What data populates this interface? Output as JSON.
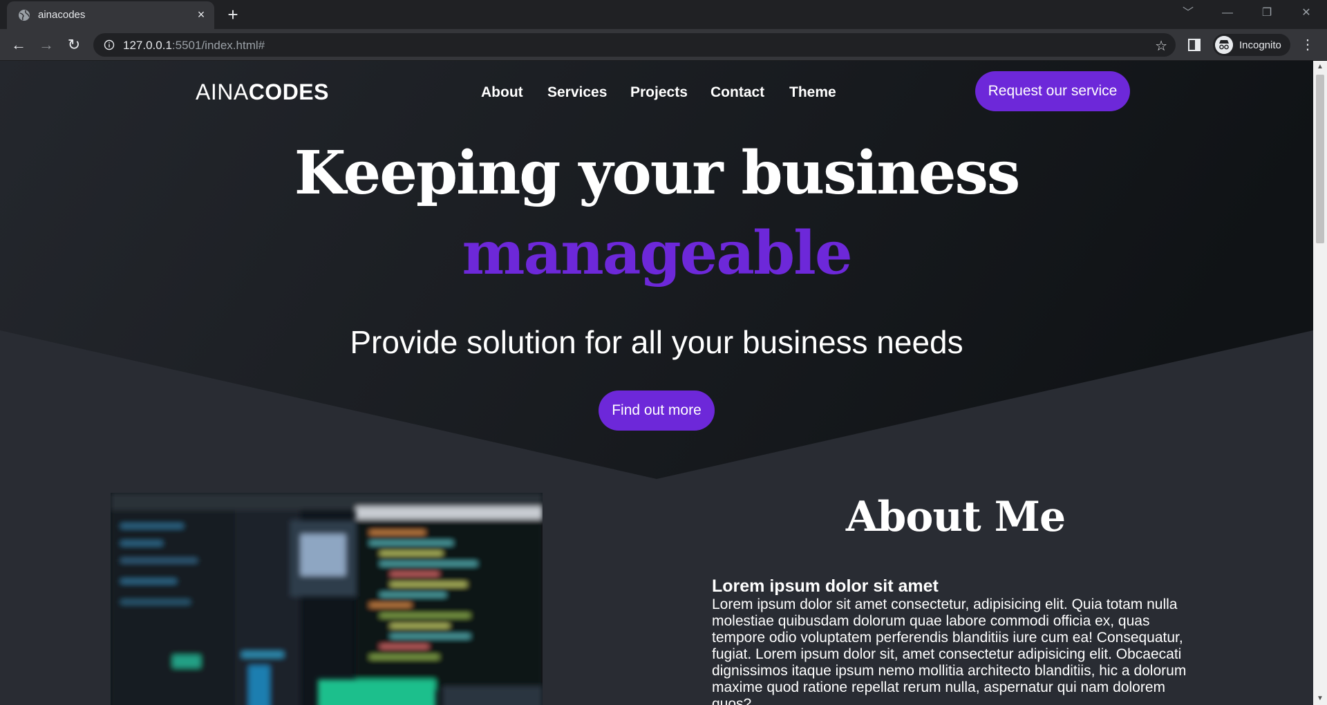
{
  "browser": {
    "tab_title": "ainacodes",
    "tab_close": "×",
    "new_tab": "+",
    "url_host": "127.0.0.1",
    "url_rest": ":5501/index.html#",
    "profile_label": "Incognito",
    "window_controls": [
      "﹀",
      "—",
      "❐",
      "✕"
    ],
    "icons": {
      "back": "←",
      "forward": "→",
      "reload": "↻",
      "bookmark": "☆",
      "menu": "⋮"
    }
  },
  "site": {
    "logo_light": "AINA",
    "logo_bold": "CODES",
    "nav": [
      "About",
      "Services",
      "Projects",
      "Contact",
      "Theme"
    ],
    "cta_label": "Request our service",
    "hero": {
      "title_line1": "Keeping your business",
      "title_line2": "manageable",
      "subtitle": "Provide solution for all your business needs",
      "button_label": "Find out more"
    },
    "about": {
      "title": "About Me",
      "heading": "Lorem ipsum dolor sit amet",
      "body": "Lorem ipsum dolor sit amet consectetur, adipisicing elit. Quia totam nulla molestiae quibusdam dolorum quae labore commodi officia ex, quas tempore odio voluptatem perferendis blanditiis iure cum ea! Consequatur, fugiat. Lorem ipsum dolor sit, amet consectetur adipisicing elit. Obcaecati dignissimos itaque ipsum nemo mollitia architecto blanditiis, hic a dolorum maxime quod ratione repellat rerum nulla, aspernatur qui nam dolorem quos?"
    }
  },
  "colors": {
    "accent": "#6d28d9",
    "page_bg": "#292c33",
    "hero_bg": "#14171b"
  }
}
